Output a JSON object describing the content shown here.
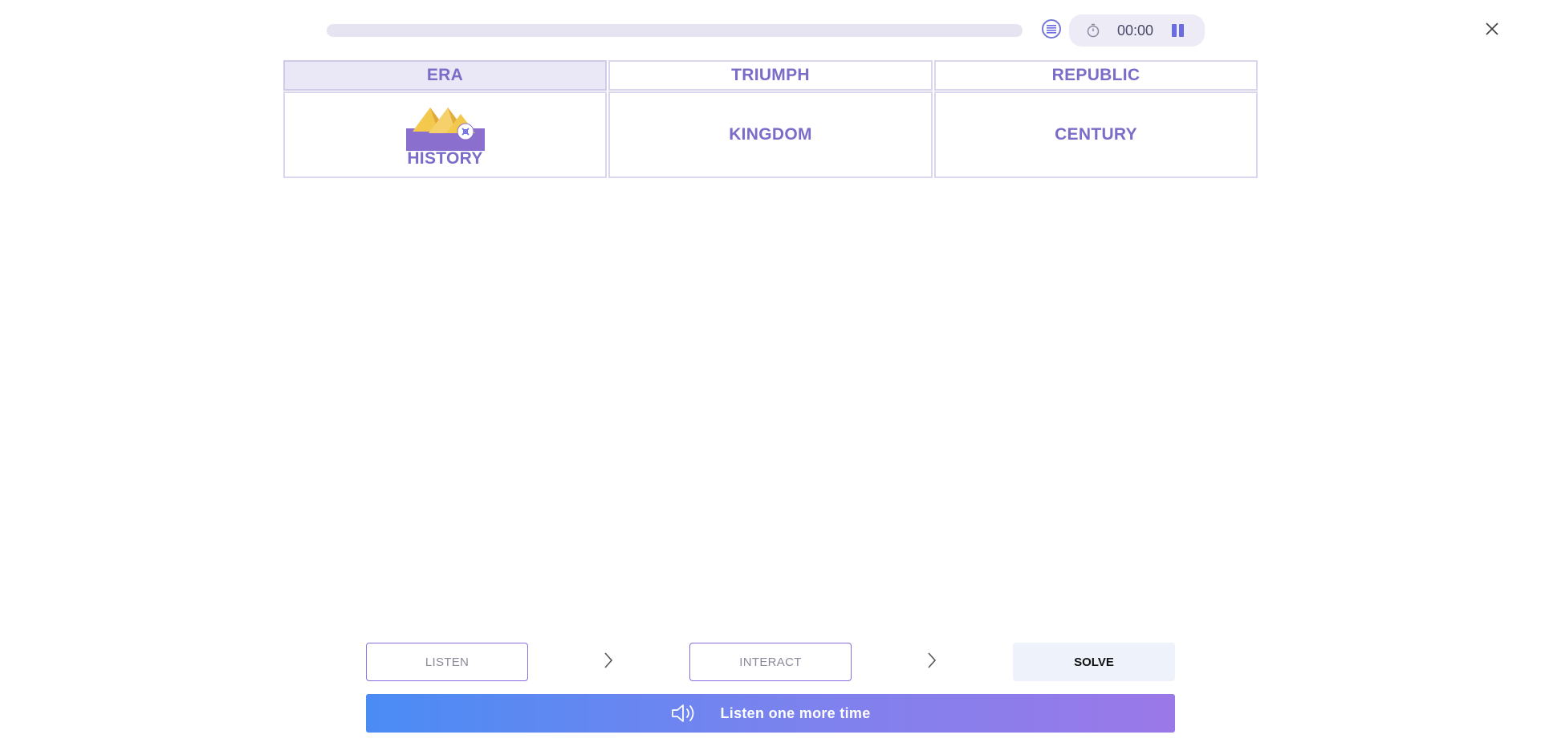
{
  "header": {
    "progress_percent": 0,
    "timer": "00:00"
  },
  "grid": {
    "headers": [
      {
        "label": "ERA",
        "active": true
      },
      {
        "label": "TRIUMPH",
        "active": false
      },
      {
        "label": "REPUBLIC",
        "active": false
      }
    ],
    "cells": [
      {
        "label": "HISTORY",
        "icon": "pyramids-icon"
      },
      {
        "label": "KINGDOM"
      },
      {
        "label": "CENTURY"
      }
    ]
  },
  "steps": {
    "listen": "LISTEN",
    "interact": "INTERACT",
    "solve": "SOLVE"
  },
  "listen_again": {
    "label": "Listen one more time"
  },
  "colors": {
    "accent": "#7a6cc8",
    "gradient_start": "#4a8cf4",
    "gradient_end": "#9b78e8"
  }
}
